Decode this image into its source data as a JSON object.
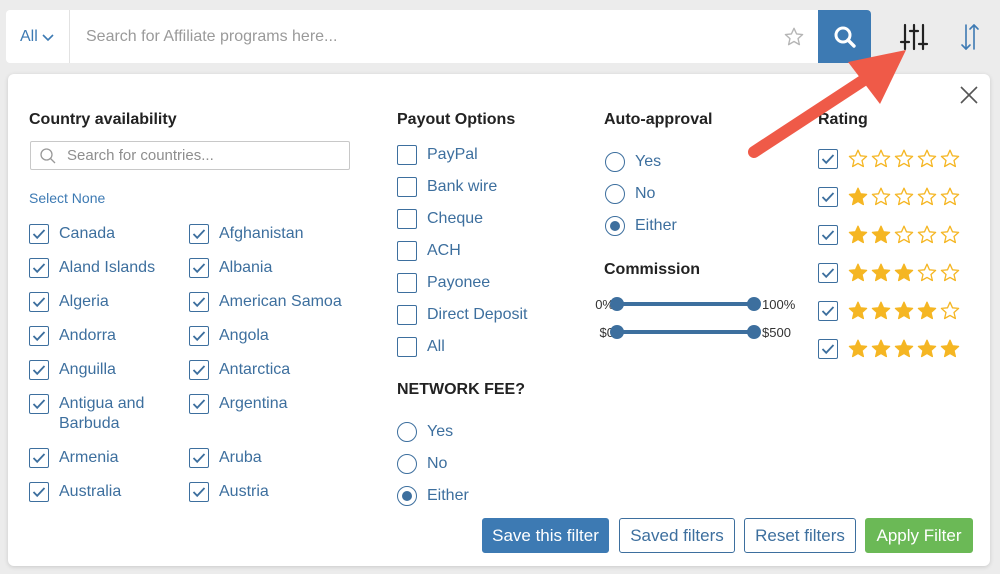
{
  "search": {
    "scope_label": "All",
    "placeholder": "Search for Affiliate programs here..."
  },
  "filters": {
    "country": {
      "heading": "Country availability",
      "search_placeholder": "Search for countries...",
      "select_none": "Select None",
      "items": [
        {
          "label": "Canada",
          "checked": true
        },
        {
          "label": "Afghanistan",
          "checked": true
        },
        {
          "label": "Aland Islands",
          "checked": true
        },
        {
          "label": "Albania",
          "checked": true
        },
        {
          "label": "Algeria",
          "checked": true
        },
        {
          "label": "American Samoa",
          "checked": true
        },
        {
          "label": "Andorra",
          "checked": true
        },
        {
          "label": "Angola",
          "checked": true
        },
        {
          "label": "Anguilla",
          "checked": true
        },
        {
          "label": "Antarctica",
          "checked": true
        },
        {
          "label": "Antigua and Barbuda",
          "checked": true
        },
        {
          "label": "Argentina",
          "checked": true
        },
        {
          "label": "Armenia",
          "checked": true
        },
        {
          "label": "Aruba",
          "checked": true
        },
        {
          "label": "Australia",
          "checked": true
        },
        {
          "label": "Austria",
          "checked": true
        }
      ]
    },
    "payout": {
      "heading": "Payout Options",
      "items": [
        {
          "label": "PayPal",
          "checked": false
        },
        {
          "label": "Bank wire",
          "checked": false
        },
        {
          "label": "Cheque",
          "checked": false
        },
        {
          "label": "ACH",
          "checked": false
        },
        {
          "label": "Payonee",
          "checked": false
        },
        {
          "label": "Direct Deposit",
          "checked": false
        },
        {
          "label": "All",
          "checked": false
        }
      ]
    },
    "network_fee": {
      "heading": "NETWORK FEE?",
      "options": [
        "Yes",
        "No",
        "Either"
      ],
      "selected": "Either"
    },
    "auto_approval": {
      "heading": "Auto-approval",
      "options": [
        "Yes",
        "No",
        "Either"
      ],
      "selected": "Either"
    },
    "commission": {
      "heading": "Commission",
      "percent": {
        "min_label": "0%",
        "max_label": "100%",
        "min": 0,
        "max": 100
      },
      "amount": {
        "min_label": "$0",
        "max_label": "$500",
        "min": 0,
        "max": 500
      }
    },
    "rating": {
      "heading": "Rating",
      "rows": [
        {
          "stars": 0,
          "checked": true
        },
        {
          "stars": 1,
          "checked": true
        },
        {
          "stars": 2,
          "checked": true
        },
        {
          "stars": 3,
          "checked": true
        },
        {
          "stars": 4,
          "checked": true
        },
        {
          "stars": 5,
          "checked": true
        }
      ]
    }
  },
  "actions": {
    "save": "Save this filter",
    "saved": "Saved filters",
    "reset": "Reset filters",
    "apply": "Apply Filter"
  },
  "colors": {
    "accent": "#3d7ab3",
    "link": "#3d6f9e",
    "apply": "#6bb956",
    "star": "#f5b623",
    "annotation": "#ef5a48"
  }
}
